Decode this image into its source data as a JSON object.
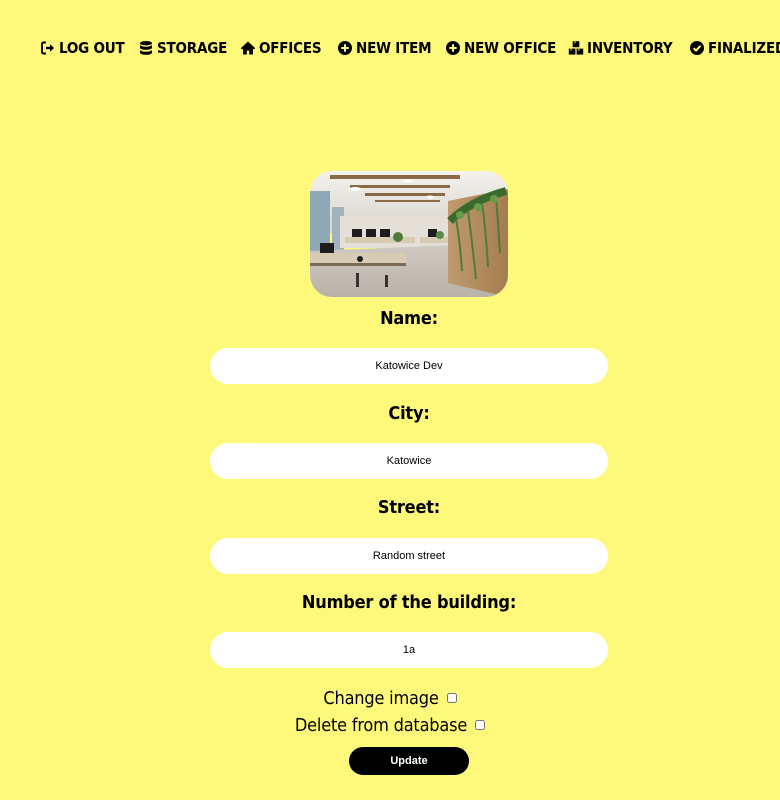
{
  "nav": {
    "items": [
      {
        "label": "LOG OUT",
        "icon": "logout-icon"
      },
      {
        "label": "STORAGE",
        "icon": "database-icon"
      },
      {
        "label": "OFFICES",
        "icon": "home-icon"
      },
      {
        "label": "NEW ITEM",
        "icon": "plus-circle-icon"
      },
      {
        "label": "NEW OFFICE",
        "icon": "plus-circle-icon"
      },
      {
        "label": "INVENTORY",
        "icon": "boxes-icon"
      },
      {
        "label": "FINALIZED",
        "icon": "check-circle-icon"
      }
    ]
  },
  "form": {
    "name_label": "Name:",
    "name_value": "Katowice Dev",
    "city_label": "City:",
    "city_value": "Katowice",
    "street_label": "Street:",
    "street_value": "Random street",
    "building_label": "Number of the building:",
    "building_value": "1a",
    "change_image_label": "Change image",
    "change_image_checked": false,
    "delete_label": "Delete from database",
    "delete_checked": false,
    "update_label": "Update"
  },
  "colors": {
    "background": "#fef97a",
    "input_background": "#ffffff",
    "button_background": "#000000",
    "button_text": "#ffffff"
  }
}
